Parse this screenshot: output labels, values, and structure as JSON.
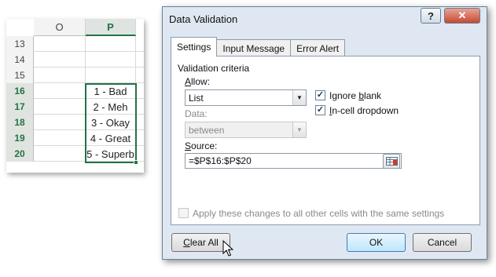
{
  "sheet": {
    "columns": [
      "O",
      "P"
    ],
    "rows": [
      {
        "num": "13",
        "value": ""
      },
      {
        "num": "14",
        "value": ""
      },
      {
        "num": "15",
        "value": ""
      },
      {
        "num": "16",
        "value": "1 - Bad"
      },
      {
        "num": "17",
        "value": "2 - Meh"
      },
      {
        "num": "18",
        "value": "3 - Okay"
      },
      {
        "num": "19",
        "value": "4 - Great"
      },
      {
        "num": "20",
        "value": "5 - Superb"
      }
    ],
    "accent_color": "#217346"
  },
  "dialog": {
    "title": "Data Validation",
    "help_label": "?",
    "close_label": "✕",
    "tabs": [
      {
        "label": "Settings",
        "active": true
      },
      {
        "label": "Input Message",
        "active": false
      },
      {
        "label": "Error Alert",
        "active": false
      }
    ],
    "section_title": "Validation criteria",
    "allow": {
      "label_pre": "",
      "label_ul": "A",
      "label_post": "llow:",
      "value": "List"
    },
    "ignore_blank": {
      "label_pre": "Ignore ",
      "label_ul": "b",
      "label_post": "lank",
      "checked": true,
      "mark": "✓"
    },
    "incell_dropdown": {
      "label_pre": "",
      "label_ul": "I",
      "label_post": "n-cell dropdown",
      "checked": true,
      "mark": "✓"
    },
    "data": {
      "label": "Data:",
      "value": "between",
      "disabled": true
    },
    "source": {
      "label_pre": "",
      "label_ul": "S",
      "label_post": "ource:",
      "value": "=$P$16:$P$20"
    },
    "apply_all": {
      "label": "Apply these changes to all other cells with the same settings",
      "checked": false,
      "disabled": true
    },
    "buttons": {
      "clear_all_ul": "C",
      "clear_all_rest": "lear All",
      "ok": "OK",
      "cancel": "Cancel"
    }
  }
}
